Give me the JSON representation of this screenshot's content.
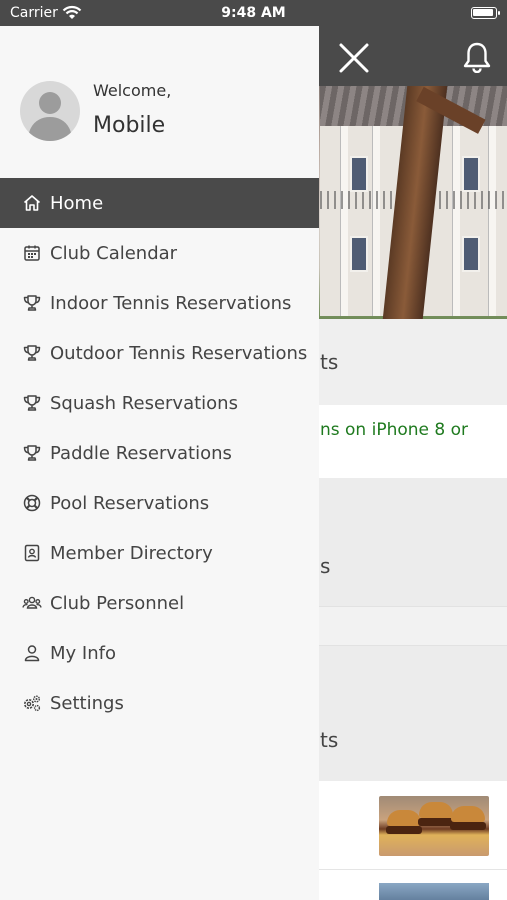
{
  "status_bar": {
    "carrier": "Carrier",
    "time": "9:48 AM"
  },
  "drawer": {
    "welcome": "Welcome,",
    "username": "Mobile",
    "items": [
      {
        "label": "Home",
        "icon": "home-icon",
        "active": true
      },
      {
        "label": "Club Calendar",
        "icon": "calendar-icon",
        "active": false
      },
      {
        "label": "Indoor Tennis Reservations",
        "icon": "trophy-icon",
        "active": false
      },
      {
        "label": "Outdoor Tennis Reservations",
        "icon": "trophy-icon",
        "active": false
      },
      {
        "label": "Squash Reservations",
        "icon": "trophy-icon",
        "active": false
      },
      {
        "label": "Paddle Reservations",
        "icon": "trophy-icon",
        "active": false
      },
      {
        "label": "Pool Reservations",
        "icon": "lifebuoy-icon",
        "active": false
      },
      {
        "label": "Member Directory",
        "icon": "contact-card-icon",
        "active": false
      },
      {
        "label": "Club Personnel",
        "icon": "group-icon",
        "active": false
      },
      {
        "label": "My Info",
        "icon": "user-icon",
        "active": false
      },
      {
        "label": "Settings",
        "icon": "gears-icon",
        "active": false
      }
    ]
  },
  "background": {
    "section1_fragment": "ts",
    "green_notice_fragment": "ns on iPhone 8 or",
    "section2_fragment": "s",
    "section3_fragment": "ts"
  },
  "colors": {
    "header": "#4a4a4a",
    "drawer": "#f7f7f7",
    "active_item": "#4a4a4a",
    "notice_green": "#1f7a1f"
  }
}
